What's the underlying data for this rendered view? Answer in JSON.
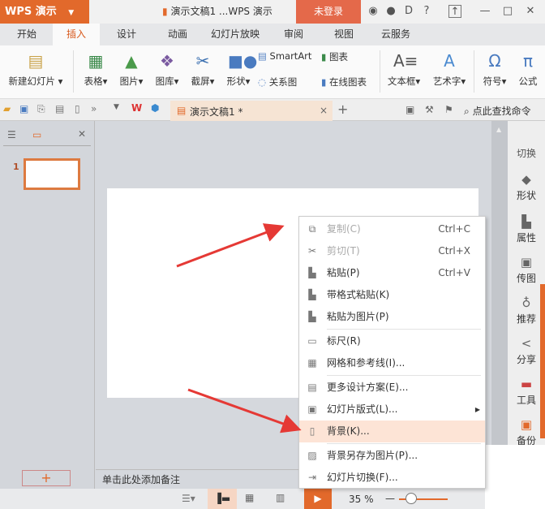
{
  "titlebar": {
    "app": "WPS 演示",
    "title": "演示文稿1 ...WPS 演示",
    "login": "未登录"
  },
  "tabs": [
    "开始",
    "插入",
    "设计",
    "动画",
    "幻灯片放映",
    "审阅",
    "视图",
    "云服务"
  ],
  "active_tab": "插入",
  "ribbon": {
    "new_slide": "新建幻灯片",
    "table": "表格",
    "picture": "图片",
    "gallery": "图库",
    "screenshot": "截屏",
    "shape": "形状",
    "smartart": "SmartArt",
    "chart": "图表",
    "relation": "关系图",
    "online_chart": "在线图表",
    "textbox": "文本框",
    "wordart": "艺术字",
    "symbol": "符号",
    "formula": "公式"
  },
  "quickbar": {
    "doc_tab": "演示文稿1 *",
    "search": "点此查找命令"
  },
  "slides_panel": {
    "slide_number": "1"
  },
  "notes": "单击此处添加备注",
  "right_sidebar": [
    "切换",
    "形状",
    "属性",
    "传图",
    "推荐",
    "分享",
    "工具",
    "备份"
  ],
  "context_menu": [
    {
      "label": "复制(C)",
      "shortcut": "Ctrl+C",
      "icon": "copy-icon",
      "disabled": true
    },
    {
      "label": "剪切(T)",
      "shortcut": "Ctrl+X",
      "icon": "cut-icon",
      "disabled": true
    },
    {
      "label": "粘贴(P)",
      "shortcut": "Ctrl+V",
      "icon": "paste-icon"
    },
    {
      "label": "带格式粘贴(K)",
      "shortcut": "",
      "icon": "paste-format-icon"
    },
    {
      "label": "粘贴为图片(P)",
      "shortcut": "",
      "icon": "paste-image-icon"
    },
    {
      "label": "标尺(R)",
      "shortcut": "",
      "icon": "ruler-icon"
    },
    {
      "label": "网格和参考线(I)...",
      "shortcut": "",
      "icon": "grid-icon"
    },
    {
      "label": "更多设计方案(E)...",
      "shortcut": "",
      "icon": "design-icon"
    },
    {
      "label": "幻灯片版式(L)...",
      "shortcut": "",
      "icon": "layout-icon",
      "submenu": true
    },
    {
      "label": "背景(K)...",
      "shortcut": "",
      "icon": "background-icon",
      "highlighted": true
    },
    {
      "label": "背景另存为图片(P)...",
      "shortcut": "",
      "icon": "save-background-icon"
    },
    {
      "label": "幻灯片切换(F)...",
      "shortcut": "",
      "icon": "transition-icon"
    }
  ],
  "status": {
    "zoom": "35 %"
  },
  "colors": {
    "accent": "#e2692b",
    "highlight": "#fde4d6",
    "arrow": "#e53935"
  }
}
